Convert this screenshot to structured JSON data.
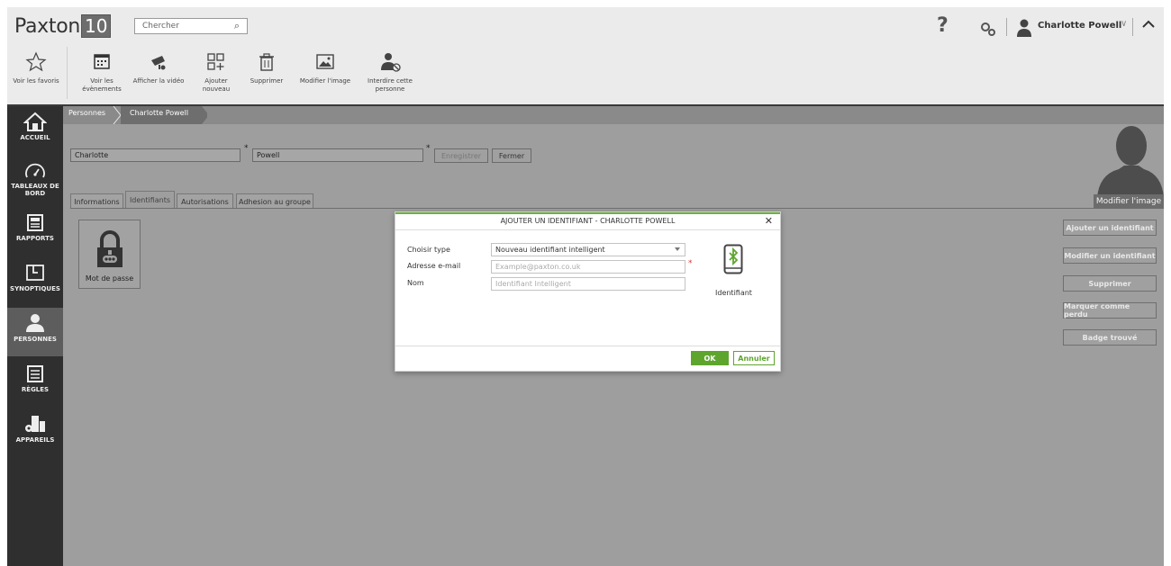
{
  "header": {
    "logo_text": "Paxton",
    "logo_num": "10",
    "search_placeholder": "Chercher",
    "help": "?",
    "user_name": "Charlotte Powell"
  },
  "toolbar": [
    {
      "label": "Voir les favoris",
      "icon": "star-icon"
    },
    {
      "label": "Voir les évènements",
      "icon": "calendar-icon"
    },
    {
      "label": "Afficher la vidéo",
      "icon": "camera-icon"
    },
    {
      "label": "Ajouter nouveau",
      "icon": "add-grid-icon"
    },
    {
      "label": "Supprimer",
      "icon": "trash-icon"
    },
    {
      "label": "Modifier l'image",
      "icon": "image-icon"
    },
    {
      "label": "Interdire cette personne",
      "icon": "block-person-icon"
    }
  ],
  "nav": [
    {
      "label": "ACCUEIL",
      "icon": "home-icon"
    },
    {
      "label": "TABLEAUX DE BORD",
      "icon": "dashboard-icon"
    },
    {
      "label": "RAPPORTS",
      "icon": "report-icon"
    },
    {
      "label": "SYNOPTIQUES",
      "icon": "floorplan-icon"
    },
    {
      "label": "PERSONNES",
      "icon": "person-icon",
      "active": true
    },
    {
      "label": "RÈGLES",
      "icon": "rules-icon"
    },
    {
      "label": "APPAREILS",
      "icon": "devices-icon"
    }
  ],
  "breadcrumb": [
    "Personnes",
    "Charlotte Powell"
  ],
  "person": {
    "first_name": "Charlotte",
    "last_name": "Powell",
    "required_mark": "*",
    "save_label": "Enregistrer",
    "close_label": "Fermer"
  },
  "tabs": [
    "Informations",
    "Identifiants",
    "Autorisations",
    "Adhesion au groupe"
  ],
  "active_tab": "Identifiants",
  "credential_card": "Mot de passe",
  "avatar_caption": "Modifier l'image",
  "right_buttons": [
    "Ajouter un identifiant",
    "Modifier un identifiant",
    "Supprimer",
    "Marquer comme perdu",
    "Badge trouvé"
  ],
  "dialog": {
    "title": "AJOUTER UN IDENTIFIANT - CHARLOTTE POWELL",
    "close": "✕",
    "type_label": "Choisir type",
    "type_value": "Nouveau identifiant intelligent",
    "email_label": "Adresse e-mail",
    "email_placeholder": "Example@paxton.co.uk",
    "name_label": "Nom",
    "name_placeholder": "Identifiant Intelligent",
    "required_mark": "*",
    "icon_label": "Identifiant",
    "ok": "OK",
    "cancel": "Annuler"
  },
  "colors": {
    "accent": "#5ea52e",
    "nav_bg": "#2f2f2f",
    "content_bg": "#9e9e9e"
  }
}
